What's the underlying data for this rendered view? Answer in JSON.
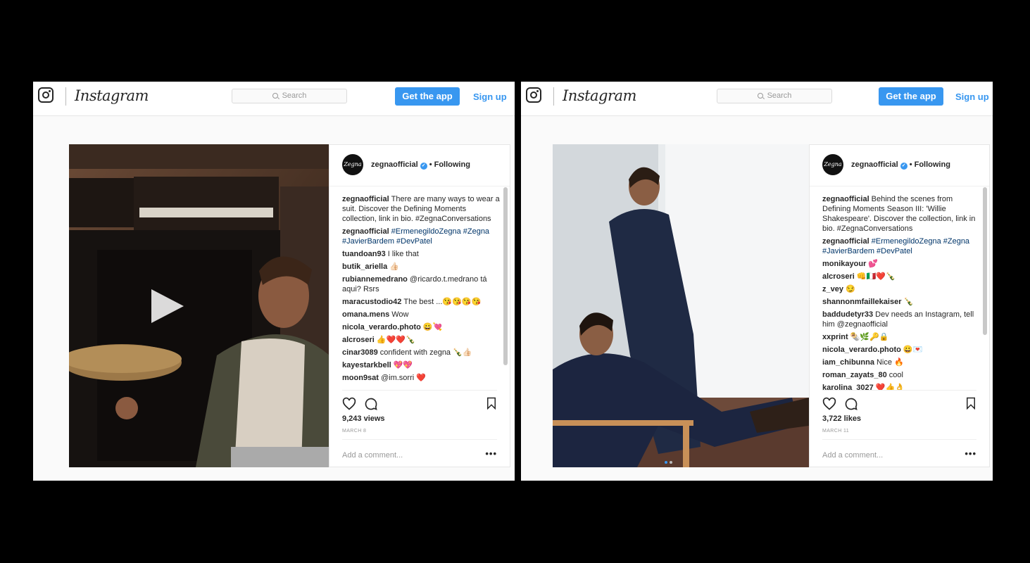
{
  "app": {
    "logo": "Instagram",
    "search_placeholder": "Search",
    "get_app_label": "Get the app",
    "signup_label": "Sign up"
  },
  "posts": [
    {
      "username": "zegnaofficial",
      "avatar_text": "Zegna",
      "following_label": "• Following",
      "comments": [
        {
          "user": "zegnaofficial",
          "text": "There are many ways to wear a suit. Discover the Defining Moments collection, link in bio. #ZegnaConversations"
        },
        {
          "user": "zegnaofficial",
          "text": "#ErmenegildoZegna #Zegna #JavierBardem #DevPatel"
        },
        {
          "user": "tuandoan93",
          "text": "I like that"
        },
        {
          "user": "butik_ariella",
          "text": "👍🏻"
        },
        {
          "user": "rubiannemedrano",
          "text": "@ricardo.t.medrano tá aqui? Rsrs"
        },
        {
          "user": "maracustodio42",
          "text": "The best ...😘😘😘😘"
        },
        {
          "user": "omana.mens",
          "text": "Wow"
        },
        {
          "user": "nicola_verardo.photo",
          "text": "😀💘"
        },
        {
          "user": "alcroseri",
          "text": "👍❤️❤️🍾"
        },
        {
          "user": "cinar3089",
          "text": "confident with zegna 🍾👍🏻"
        },
        {
          "user": "kayestarkbell",
          "text": "💖💖"
        },
        {
          "user": "moon9sat",
          "text": "@im.sorri ❤️"
        }
      ],
      "count_label": "9,243 views",
      "date": "MARCH 8",
      "add_comment_placeholder": "Add a comment...",
      "more_label": "•••"
    },
    {
      "username": "zegnaofficial",
      "avatar_text": "Zegna",
      "following_label": "• Following",
      "comments": [
        {
          "user": "zegnaofficial",
          "text": "Behind the scenes from Defining Moments Season III: 'Willie Shakespeare'. Discover the collection, link in bio. #ZegnaConversations"
        },
        {
          "user": "zegnaofficial",
          "text": "#ErmenegildoZegna #Zegna #JavierBardem #DevPatel"
        },
        {
          "user": "monikayour",
          "text": "💕"
        },
        {
          "user": "alcroseri",
          "text": "👊🇮🇹❤️🍾"
        },
        {
          "user": "z_vey",
          "text": "😏"
        },
        {
          "user": "shannonmfaillekaiser",
          "text": "🍾"
        },
        {
          "user": "baddudetyr33",
          "text": "Dev needs an Instagram, tell him @zegnaofficial"
        },
        {
          "user": "xxprint",
          "text": "🌯🌿🔑🔒"
        },
        {
          "user": "nicola_verardo.photo",
          "text": "😀💌"
        },
        {
          "user": "iam_chibunna",
          "text": "Nice 🔥"
        },
        {
          "user": "roman_zayats_80",
          "text": "cool"
        },
        {
          "user": "karolina_3027",
          "text": "❤️👍👌"
        }
      ],
      "count_label": "3,722 likes",
      "date": "MARCH 11",
      "add_comment_placeholder": "Add a comment...",
      "more_label": "•••"
    }
  ]
}
